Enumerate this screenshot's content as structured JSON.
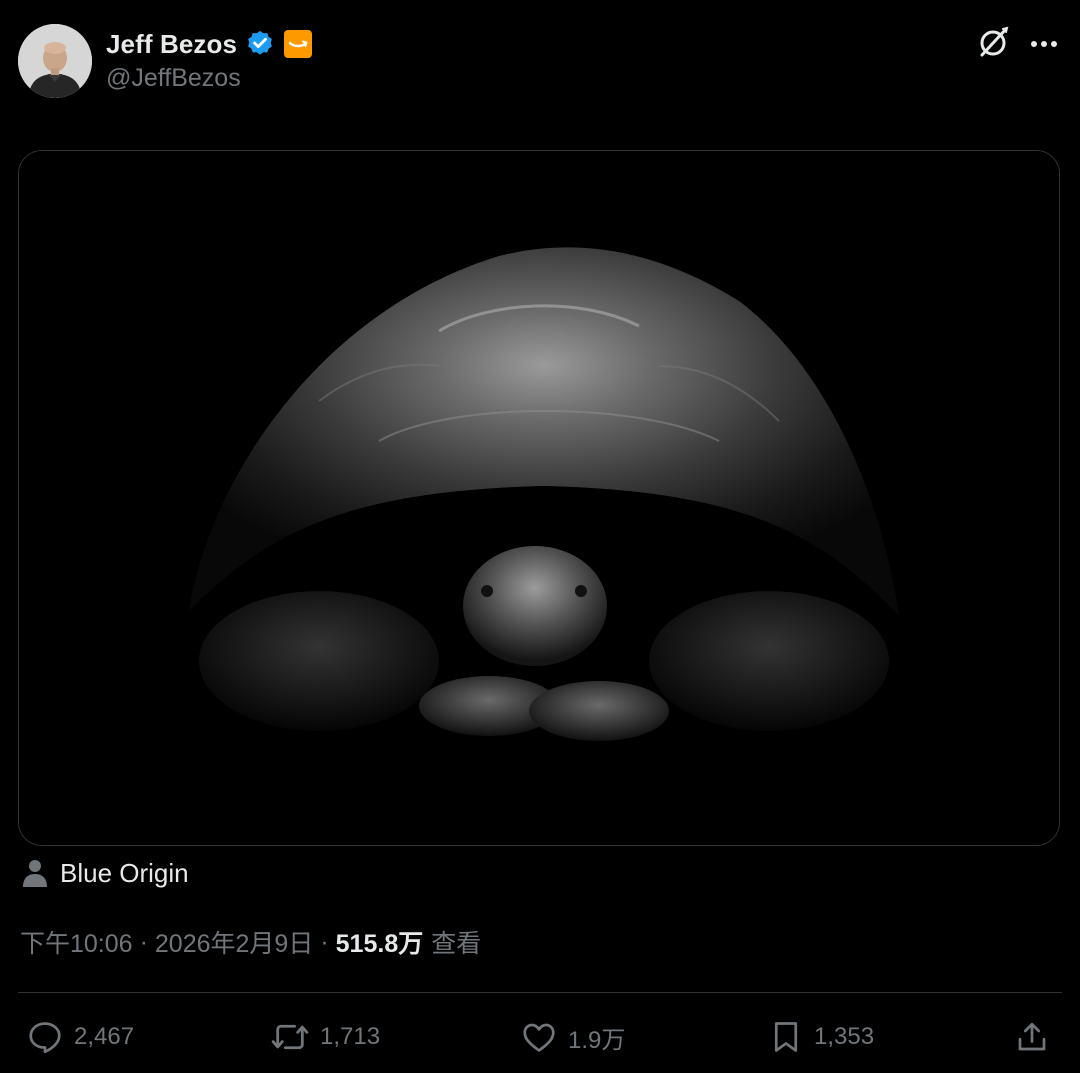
{
  "tweet": {
    "author": {
      "display_name": "Jeff Bezos",
      "handle": "@JeffBezos",
      "verified": true,
      "affiliate_badge": "amazon-smile-icon",
      "avatar": "avatar-photo"
    },
    "header_icons": [
      "grok-icon",
      "more-icon"
    ],
    "media": {
      "type": "photo",
      "subject_icon": "tortoise-photo"
    },
    "tagged_user": {
      "icon": "person-icon",
      "name": "Blue Origin"
    },
    "meta": {
      "time": "下午10:06",
      "separator": "·",
      "date": "2026年2月9日",
      "views_count": "515.8万",
      "views_label": "查看"
    },
    "actions": {
      "reply": {
        "icon": "reply-icon",
        "count": "2,467"
      },
      "repost": {
        "icon": "repost-icon",
        "count": "1,713"
      },
      "like": {
        "icon": "heart-icon",
        "count": "1.9万"
      },
      "bookmark": {
        "icon": "bookmark-icon",
        "count": "1,353"
      },
      "share": {
        "icon": "share-icon"
      }
    }
  },
  "colors": {
    "background": "#000000",
    "text_primary": "#e7e9ea",
    "text_secondary": "#71767b",
    "border": "#2f3336",
    "verified_blue": "#1d9bf0",
    "affiliate_orange": "#ff9900"
  }
}
